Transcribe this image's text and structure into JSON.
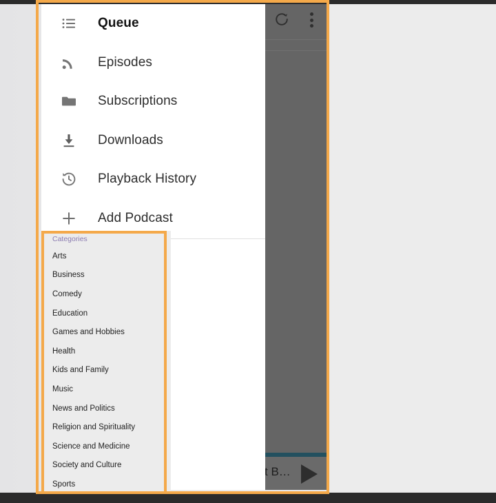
{
  "app": {
    "window_title": "Podcast App Navigation Drawer"
  },
  "toolbar": {
    "refresh_label": "refresh",
    "overflow_label": "more options"
  },
  "drawer": {
    "items": [
      {
        "label": "Queue",
        "icon": "list-icon",
        "active": true
      },
      {
        "label": "Episodes",
        "icon": "rss-icon",
        "active": false
      },
      {
        "label": "Subscriptions",
        "icon": "folder-icon",
        "active": false
      },
      {
        "label": "Downloads",
        "icon": "download-icon",
        "active": false
      },
      {
        "label": "Playback History",
        "icon": "history-icon",
        "active": false
      },
      {
        "label": "Add Podcast",
        "icon": "plus-icon",
        "active": false
      }
    ]
  },
  "categories": {
    "header": "Categories",
    "header_color": "#8b7bb0",
    "items": [
      "Arts",
      "Business",
      "Comedy",
      "Education",
      "Games and Hobbies",
      "Health",
      "Kids and Family",
      "Music",
      "News and Politics",
      "Religion and Spirituality",
      "Science and Medicine",
      "Society and Culture",
      "Sports"
    ]
  },
  "player": {
    "title": "t B…",
    "play_label": "play"
  },
  "highlight": {
    "color": "#f4a94a"
  }
}
